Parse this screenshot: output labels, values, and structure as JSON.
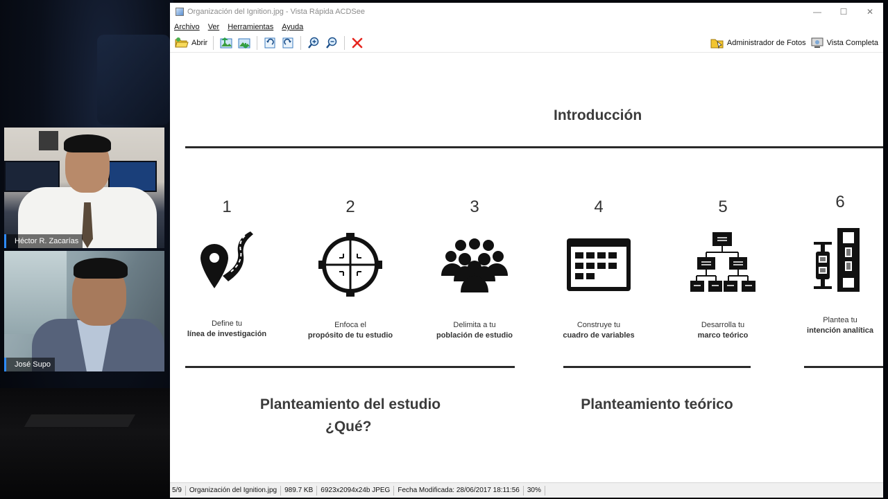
{
  "call": {
    "participants": [
      {
        "name": "Héctor R. Zacarías"
      },
      {
        "name": "José Supo"
      }
    ]
  },
  "window": {
    "title": "Organización del Ignition.jpg - Vista Rápida ACDSee",
    "controls": {
      "minimize": "—",
      "maximize": "☐",
      "close": "✕"
    }
  },
  "menu": {
    "items": [
      {
        "label": "Archivo"
      },
      {
        "label": "Ver"
      },
      {
        "label": "Herramientas"
      },
      {
        "label": "Ayuda"
      }
    ]
  },
  "toolbar": {
    "open_label": "Abrir",
    "photo_manager_label": "Administrador de Fotos",
    "full_view_label": "Vista Completa",
    "accent": "#e5261f"
  },
  "slide": {
    "title": "Introducción",
    "steps": [
      {
        "number": "1",
        "line1": "Define tu",
        "line2": "línea de investigación",
        "icon": "map-pin-road-icon"
      },
      {
        "number": "2",
        "line1": "Enfoca el",
        "line2": "propósito de tu estudio",
        "icon": "crosshair-icon"
      },
      {
        "number": "3",
        "line1": "Delimita a tu",
        "line2": "población de estudio",
        "icon": "crowd-icon"
      },
      {
        "number": "4",
        "line1": "Construye tu",
        "line2": "cuadro de variables",
        "icon": "calendar-grid-icon"
      },
      {
        "number": "5",
        "line1": "Desarrolla tu",
        "line2": "marco teórico",
        "icon": "hierarchy-icon"
      },
      {
        "number": "6",
        "line1": "Plantea tu",
        "line2": "intención analítica",
        "icon": "dna-scan-icon"
      }
    ],
    "section_study": {
      "title": "Planteamiento del estudio",
      "subtitle": "¿Qué?"
    },
    "section_theory": {
      "title": "Planteamiento teórico"
    }
  },
  "status": {
    "index": "5/9",
    "filename": "Organización del Ignition.jpg",
    "filesize": "989.7 KB",
    "dimensions": "6923x2094x24b JPEG",
    "modified": "Fecha Modificada: 28/06/2017 18:11:56",
    "zoom": "30%"
  }
}
